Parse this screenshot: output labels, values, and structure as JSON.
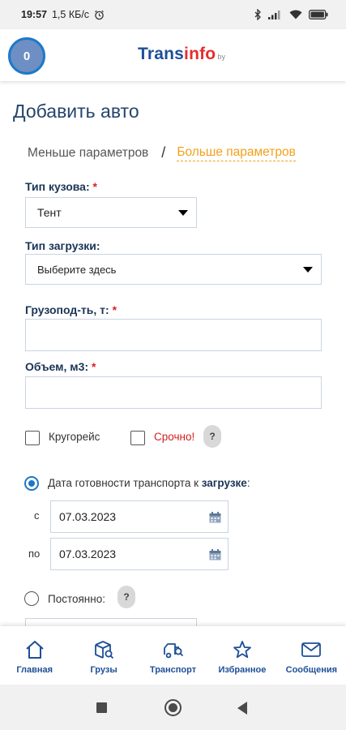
{
  "status_bar": {
    "time": "19:57",
    "speed": "1,5 КБ/с",
    "battery_level": 0.9
  },
  "header": {
    "avatar_text": "0",
    "logo_part1": "Trans",
    "logo_part2": "info",
    "logo_suffix": "by",
    "colors": {
      "brand_blue": "#1d4f96",
      "brand_red": "#e32e2e",
      "accent_orange": "#f2a01a"
    }
  },
  "page": {
    "title": "Добавить авто",
    "less_params": "Меньше параметров",
    "separator": "/",
    "more_params": "Больше параметров"
  },
  "form": {
    "body_type": {
      "label": "Тип кузова:",
      "required_mark": "*",
      "value": "Тент"
    },
    "load_type": {
      "label": "Тип загрузки:",
      "value": "Выберите здесь"
    },
    "capacity": {
      "label": "Грузопод-ть, т:",
      "required_mark": "*",
      "value": ""
    },
    "volume": {
      "label": "Объем, м3:",
      "required_mark": "*",
      "value": ""
    },
    "round_trip": {
      "label": "Кругорейс",
      "checked": false
    },
    "urgent": {
      "label": "Срочно!",
      "checked": false
    },
    "help_mark": "?",
    "readiness": {
      "selected": true,
      "label_prefix": "Дата готовности транспорта к ",
      "label_bold": "загрузке",
      "label_suffix": ":",
      "from_prefix": "с",
      "from_date": "07.03.2023",
      "to_prefix": "по",
      "to_date": "07.03.2023"
    },
    "permanent": {
      "selected": false,
      "label": "Постоянно:"
    }
  },
  "bottom_nav": [
    {
      "label": "Главная",
      "icon": "home-icon"
    },
    {
      "label": "Грузы",
      "icon": "cargo-icon"
    },
    {
      "label": "Транспорт",
      "icon": "truck-icon"
    },
    {
      "label": "Избранное",
      "icon": "star-icon"
    },
    {
      "label": "Сообщения",
      "icon": "mail-icon"
    }
  ],
  "system_nav": [
    "recents-icon",
    "home-circle-icon",
    "back-icon"
  ]
}
